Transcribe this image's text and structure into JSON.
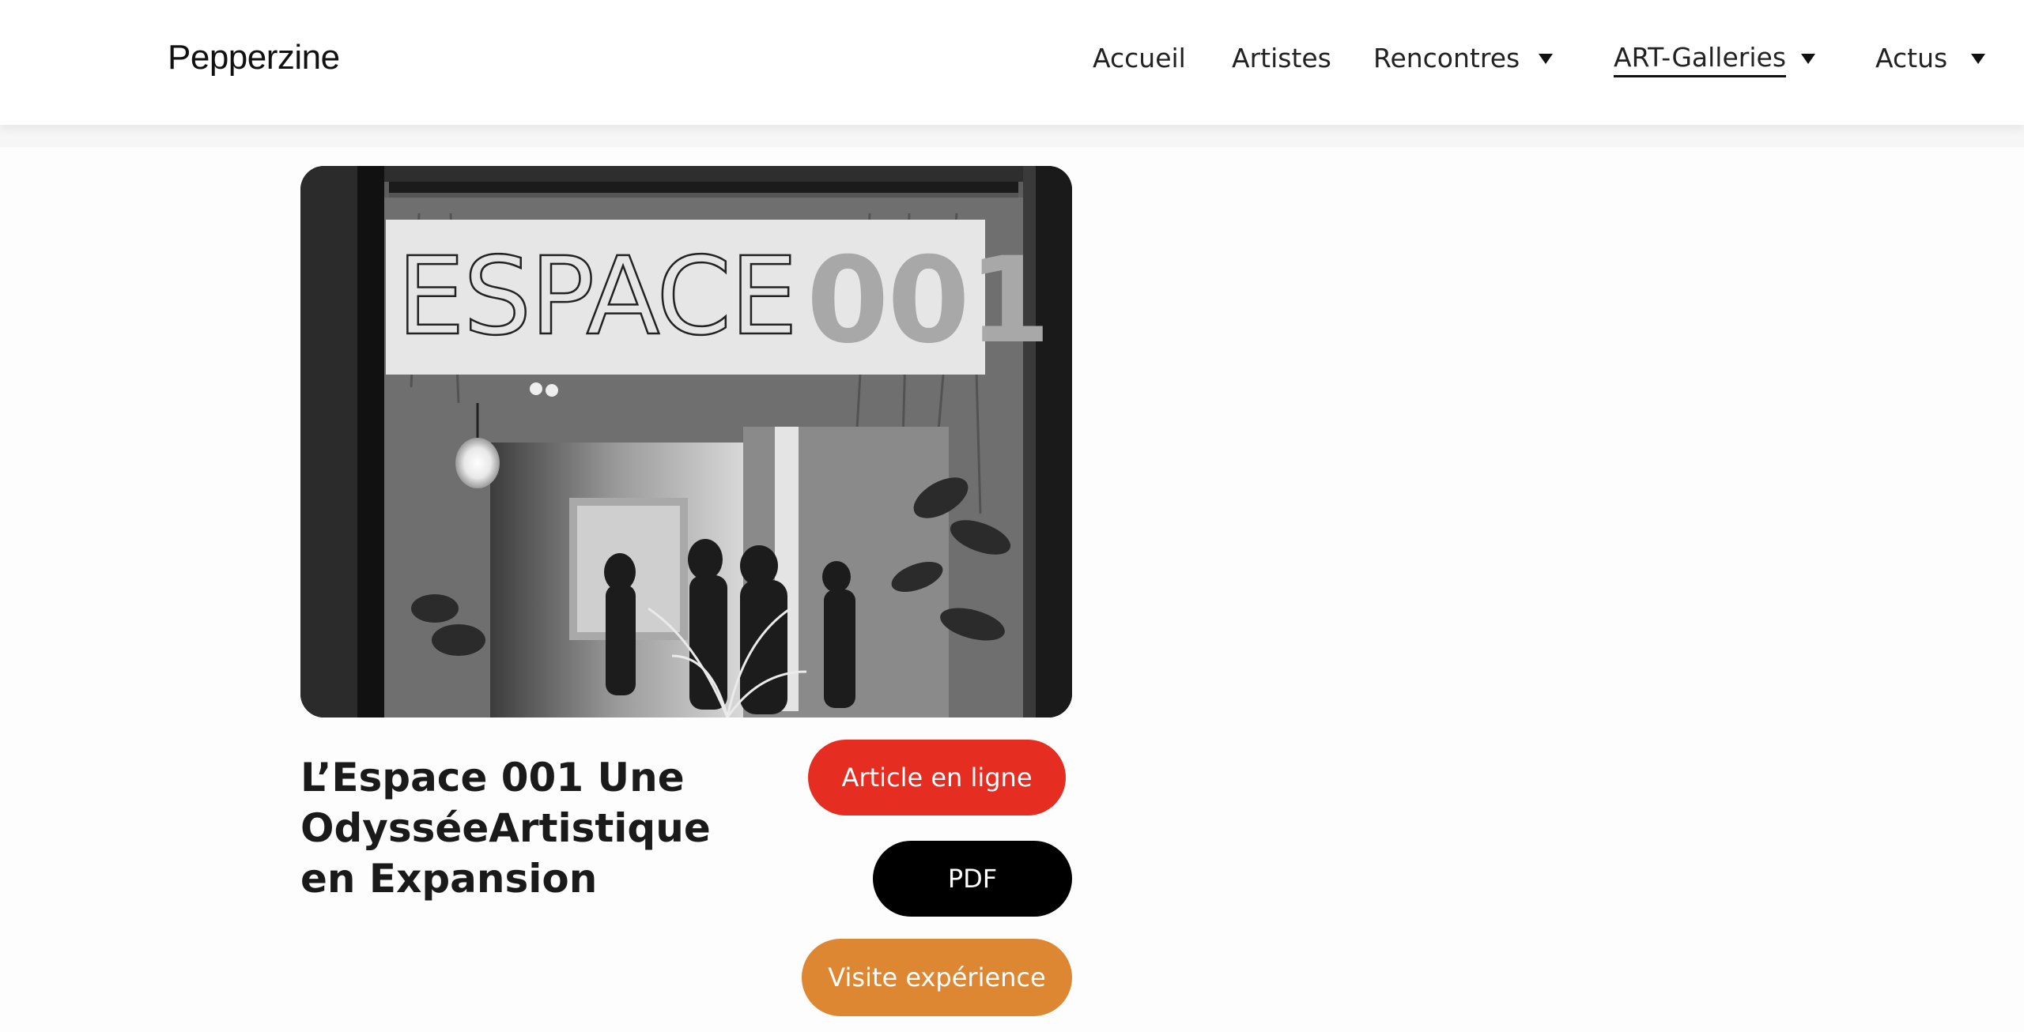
{
  "header": {
    "logo": "Pepperzine",
    "nav": [
      {
        "label": "Accueil",
        "has_dropdown": false,
        "active": false
      },
      {
        "label": "Artistes",
        "has_dropdown": false,
        "active": false
      },
      {
        "label": "Rencontres",
        "has_dropdown": true,
        "active": false
      },
      {
        "label": "ART-Galleries",
        "has_dropdown": true,
        "active": true
      },
      {
        "label": "Actus",
        "has_dropdown": true,
        "active": false
      }
    ]
  },
  "card": {
    "image": {
      "sign_text_outline": "ESPACE",
      "sign_text_bold": "001"
    },
    "title": "L’Espace 001 Une OdysséeArtistique en Expansion",
    "buttons": {
      "article": "Article en ligne",
      "pdf": "PDF",
      "visite": "Visite expérience"
    }
  },
  "colors": {
    "article_button": "#e52d22",
    "pdf_button": "#000000",
    "visite_button": "#de8732",
    "header_bg": "#ffffff",
    "page_bg": "#fdfdfd"
  },
  "icons": {
    "dropdown": "caret-down-icon"
  }
}
